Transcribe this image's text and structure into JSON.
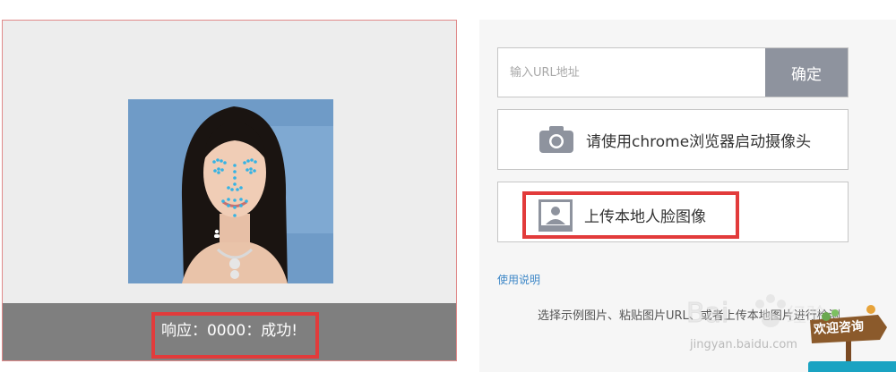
{
  "left_panel": {
    "status": "响应：0000：成功!"
  },
  "right_panel": {
    "url_placeholder": "输入URL地址",
    "confirm_label": "确定",
    "camera_label": "请使用chrome浏览器启动摄像头",
    "upload_label": "上传本地人脸图像",
    "help_link": "使用说明",
    "description": "选择示例图片、粘贴图片URL、或者上传本地图片进行检测"
  },
  "overlays": {
    "watermark_url": "jingyan.baidu.com",
    "consult_label": "欢迎咨询"
  },
  "colors": {
    "highlight": "#e23b3b",
    "status_bar": "#7f7f7f",
    "confirm_button": "#8e939e",
    "link": "#3d87c7",
    "landmark_dots": "#34b3e4"
  },
  "icons": [
    "camera-icon",
    "portrait-icon",
    "user-icon"
  ]
}
